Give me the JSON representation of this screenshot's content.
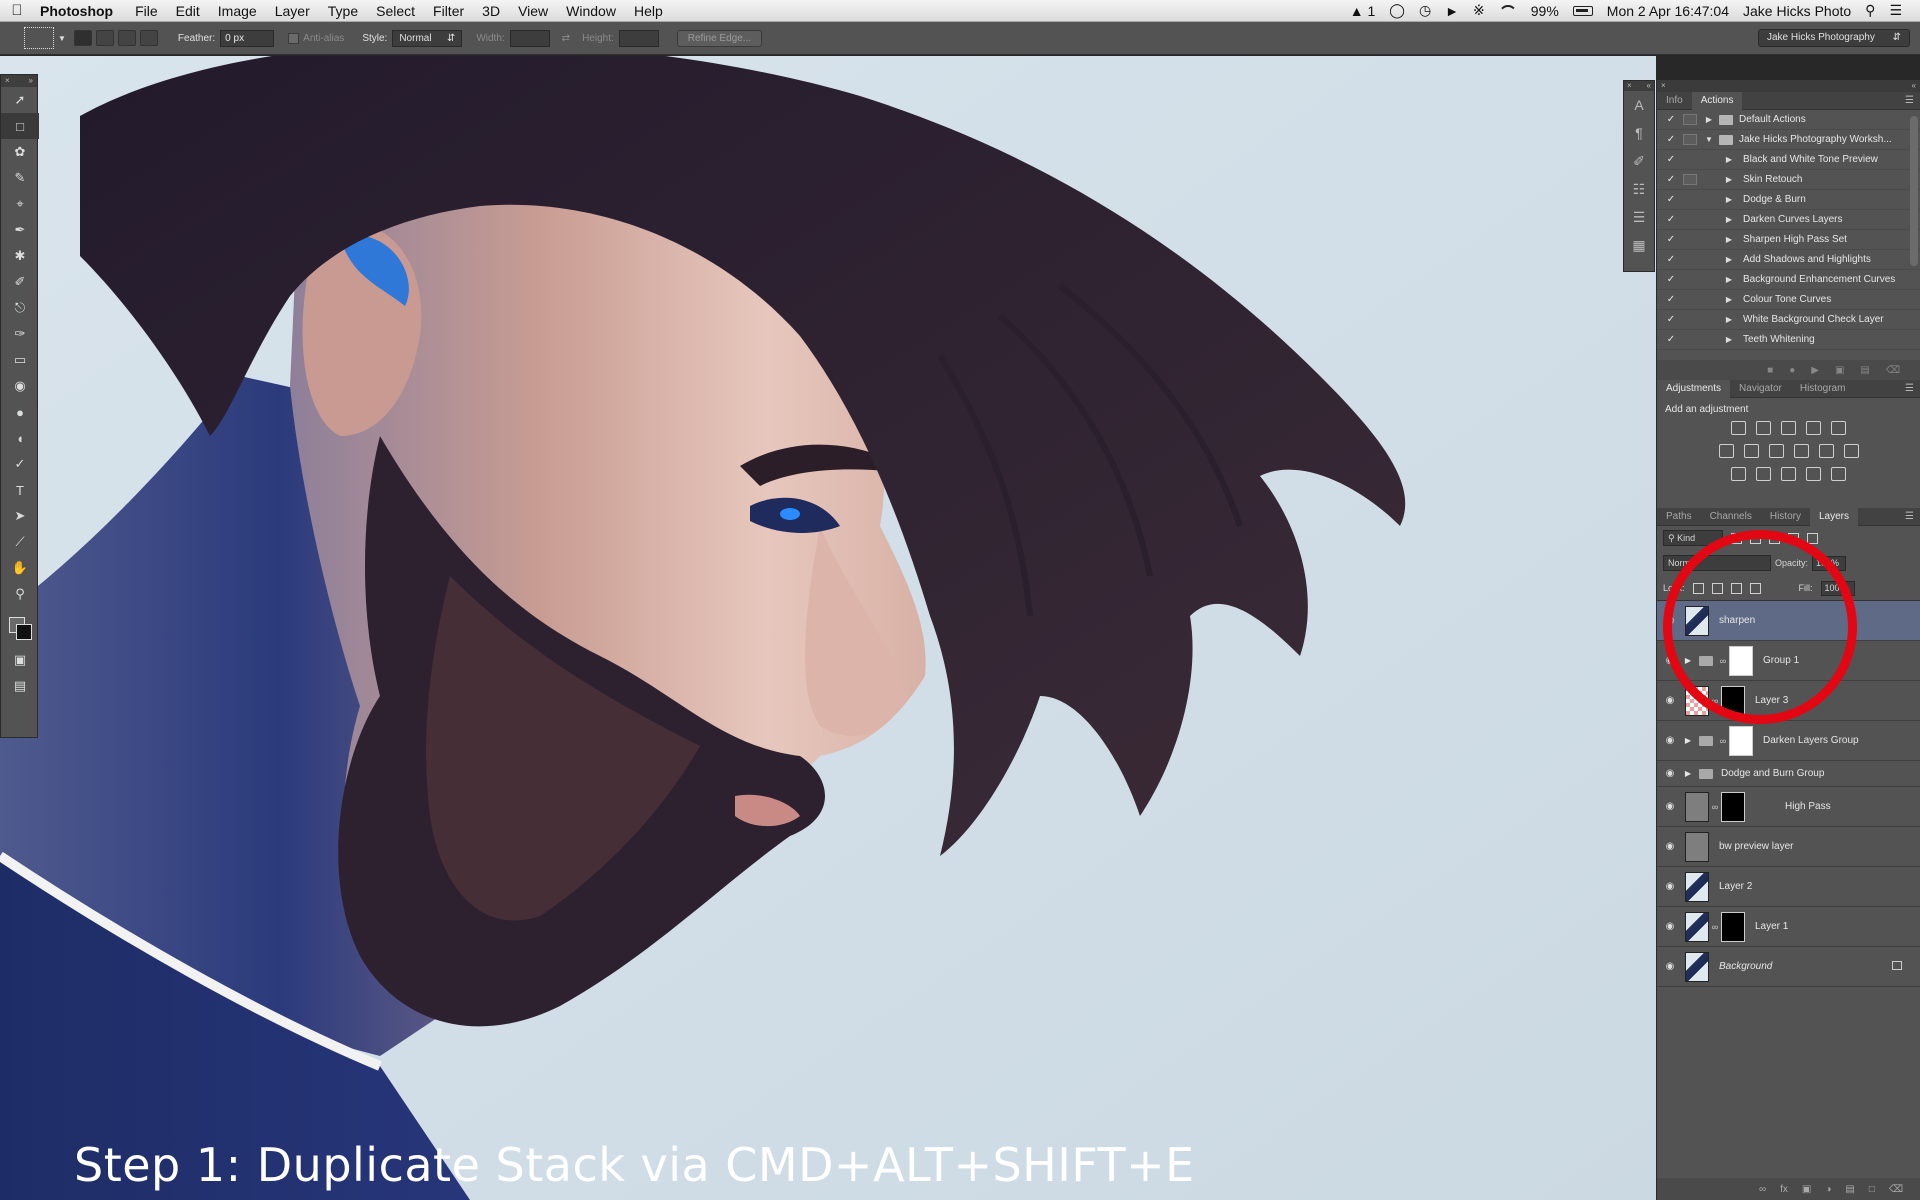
{
  "menubar": {
    "app_name": "Photoshop",
    "menus": [
      "File",
      "Edit",
      "Image",
      "Layer",
      "Type",
      "Select",
      "Filter",
      "3D",
      "View",
      "Window",
      "Help"
    ],
    "status_adobe": "1",
    "battery": "99%",
    "datetime": "Mon 2 Apr  16:47:04",
    "user": "Jake Hicks Photo"
  },
  "options": {
    "feather_label": "Feather:",
    "feather_value": "0 px",
    "antialias_label": "Anti-alias",
    "style_label": "Style:",
    "style_value": "Normal",
    "width_label": "Width:",
    "height_label": "Height:",
    "refine_label": "Refine Edge...",
    "workspace": "Jake Hicks Photography"
  },
  "caption": "Step 1: Duplicate Stack via CMD+ALT+SHIFT+E",
  "actions_panel": {
    "tabs": [
      "Info",
      "Actions"
    ],
    "active_tab": "Actions",
    "rows": [
      {
        "label": "Default Actions",
        "level": 0,
        "open": false,
        "dialog": true
      },
      {
        "label": "Jake Hicks Photography Worksh...",
        "level": 0,
        "open": true,
        "dialog": true
      },
      {
        "label": "Black and White Tone Preview",
        "level": 1,
        "dialog": false
      },
      {
        "label": "Skin Retouch",
        "level": 1,
        "dialog": true
      },
      {
        "label": "Dodge & Burn",
        "level": 1,
        "dialog": false
      },
      {
        "label": "Darken Curves Layers",
        "level": 1,
        "dialog": false
      },
      {
        "label": "Sharpen High Pass Set",
        "level": 1,
        "dialog": false
      },
      {
        "label": "Add Shadows and Highlights",
        "level": 1,
        "dialog": false
      },
      {
        "label": "Background Enhancement Curves",
        "level": 1,
        "dialog": false
      },
      {
        "label": "Colour Tone Curves",
        "level": 1,
        "dialog": false
      },
      {
        "label": "White Background Check Layer",
        "level": 1,
        "dialog": false
      },
      {
        "label": "Teeth Whitening",
        "level": 1,
        "dialog": false
      }
    ]
  },
  "adjustments_panel": {
    "tabs": [
      "Adjustments",
      "Navigator",
      "Histogram"
    ],
    "active_tab": "Adjustments",
    "title": "Add an adjustment"
  },
  "layers_panel": {
    "tabs": [
      "Paths",
      "Channels",
      "History",
      "Layers"
    ],
    "active_tab": "Layers",
    "kind_label": "Kind",
    "blend_mode": "Norm",
    "opacity_label": "Opacity:",
    "opacity_value": "100%",
    "lock_label": "Lock:",
    "fill_label": "Fill:",
    "fill_value": "100%",
    "layers": [
      {
        "name": "sharpen",
        "selected": true,
        "kind": "pixel"
      },
      {
        "name": "Group 1",
        "kind": "group"
      },
      {
        "name": "Layer 3",
        "kind": "masked"
      },
      {
        "name": "Darken Layers Group",
        "kind": "group"
      },
      {
        "name": "Dodge and Burn Group",
        "kind": "group-plain"
      },
      {
        "name": "High Pass",
        "kind": "gray-masked"
      },
      {
        "name": "bw preview layer",
        "kind": "gray"
      },
      {
        "name": "Layer 2",
        "kind": "pixel"
      },
      {
        "name": "Layer 1",
        "kind": "masked-pixel"
      },
      {
        "name": "Background",
        "kind": "background"
      }
    ]
  },
  "colors": {
    "accent_selected": "#5f6b86",
    "annotation": "#e30613"
  }
}
